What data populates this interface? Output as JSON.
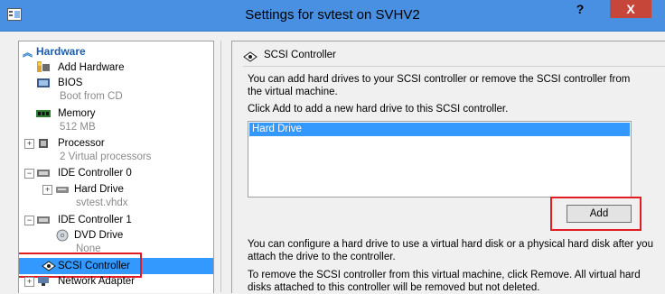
{
  "window": {
    "title": "Settings for svtest on SVHV2",
    "help_glyph": "?",
    "close_glyph": "X"
  },
  "sidebar": {
    "section_title": "Hardware",
    "items": [
      {
        "label": "Add Hardware",
        "icon": "add-hardware-icon"
      },
      {
        "label": "BIOS",
        "sub": "Boot from CD",
        "icon": "bios-icon"
      },
      {
        "label": "Memory",
        "sub": "512 MB",
        "icon": "memory-icon"
      },
      {
        "label": "Processor",
        "sub": "2 Virtual processors",
        "icon": "processor-icon",
        "expander": "+"
      },
      {
        "label": "IDE Controller 0",
        "icon": "ide-controller-icon",
        "expander": "−"
      },
      {
        "label": "Hard Drive",
        "sub": "svtest.vhdx",
        "icon": "hard-drive-icon",
        "expander": "+"
      },
      {
        "label": "IDE Controller 1",
        "icon": "ide-controller-icon",
        "expander": "−"
      },
      {
        "label": "DVD Drive",
        "sub": "None",
        "icon": "dvd-drive-icon"
      },
      {
        "label": "SCSI Controller",
        "icon": "scsi-controller-icon",
        "selected": true
      },
      {
        "label": "Network Adapter",
        "icon": "network-adapter-icon",
        "expander": "+"
      }
    ]
  },
  "panel": {
    "title": "SCSI Controller",
    "intro": "You can add hard drives to your SCSI controller or remove the SCSI controller from the virtual machine.",
    "instruction": "Click Add to add a new hard drive to this SCSI controller.",
    "list_items": [
      "Hard Drive"
    ],
    "add_label": "Add",
    "configure_text": "You can configure a hard drive to use a virtual hard disk or a physical hard disk after you attach the drive to the controller.",
    "remove_text": "To remove the SCSI controller from this virtual machine, click Remove. All virtual hard disks attached to this controller will be removed but not deleted."
  },
  "colors": {
    "titlebar": "#4a90e2",
    "close": "#c7463a",
    "selection": "#3399ff",
    "highlight_box": "#e21c23"
  }
}
